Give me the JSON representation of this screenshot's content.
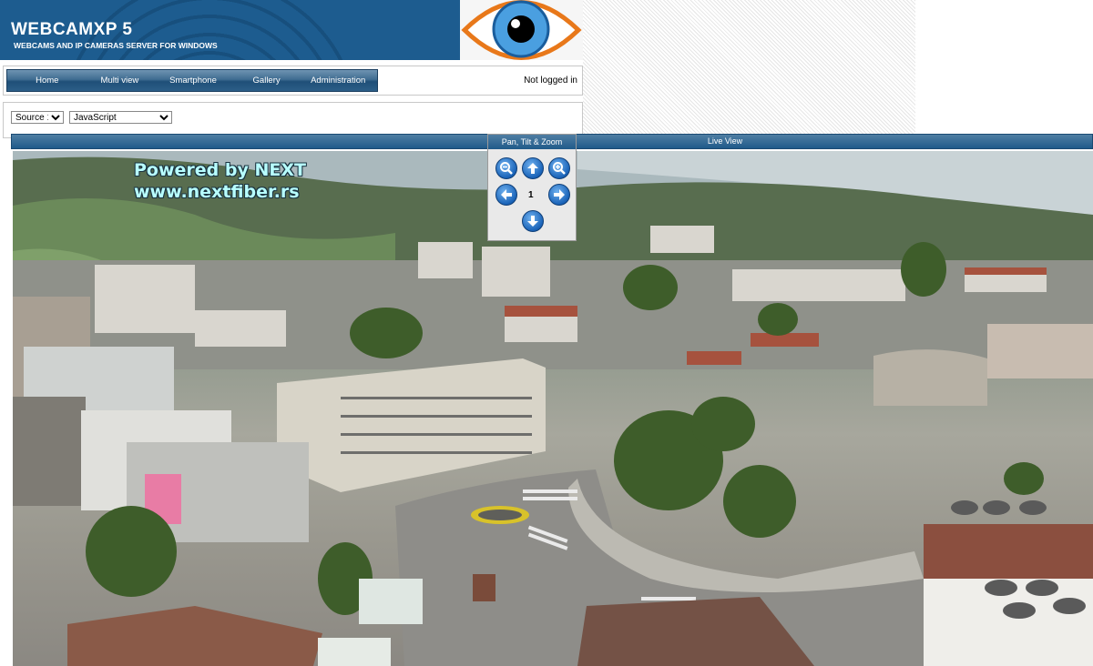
{
  "header": {
    "title": "WEBCAMXP 5",
    "subtitle": "WEBCAMS AND IP CAMERAS SERVER FOR WINDOWS"
  },
  "nav": {
    "items": [
      "Home",
      "Multi view",
      "Smartphone",
      "Gallery",
      "Administration"
    ],
    "login_status": "Not logged in"
  },
  "controls": {
    "source_selected": "Source 1",
    "mode_selected": "JavaScript"
  },
  "live_view": {
    "title": "Live View",
    "overlay_line1": "Powered by NEXT",
    "overlay_line2": "www.nextfiber.rs"
  },
  "ptz": {
    "title": "Pan, Tilt & Zoom",
    "preset": "1",
    "icons": [
      "zoom-out-icon",
      "arrow-up-icon",
      "zoom-in-icon",
      "arrow-left-icon",
      "arrow-right-icon",
      "arrow-down-icon"
    ]
  },
  "colors": {
    "nav_blue": "#2c5e87",
    "banner_blue": "#1d5c8f",
    "button_blue": "#1a63b8"
  }
}
